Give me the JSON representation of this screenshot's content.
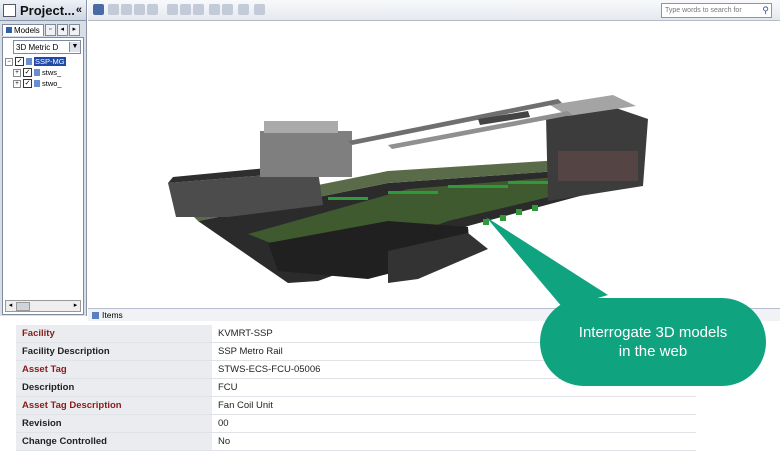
{
  "project_panel": {
    "title": "Project...",
    "collapse_glyph": "«",
    "tab_label": "Models",
    "view_select": "3D Metric D",
    "tree": [
      {
        "label": "SSP-MG",
        "selected": true,
        "expander": "−"
      },
      {
        "label": "stws_",
        "selected": false,
        "expander": "+"
      },
      {
        "label": "stwo_",
        "selected": false,
        "expander": "+"
      }
    ]
  },
  "toolbar": {
    "search_placeholder": "Type words to search for"
  },
  "status_bar": {
    "label": "Items"
  },
  "properties": [
    {
      "key": "Facility",
      "value": "KVMRT-SSP",
      "highlight": true
    },
    {
      "key": "Facility Description",
      "value": "SSP Metro Rail",
      "highlight": false
    },
    {
      "key": "Asset Tag",
      "value": "STWS-ECS-FCU-05006",
      "highlight": true
    },
    {
      "key": "Description",
      "value": "FCU",
      "highlight": false
    },
    {
      "key": "Asset Tag Description",
      "value": "Fan Coil Unit",
      "highlight": true
    },
    {
      "key": "Revision",
      "value": "00",
      "highlight": false
    },
    {
      "key": "Change Controlled",
      "value": "No",
      "highlight": false
    }
  ],
  "callout": {
    "text": "Interrogate 3D models in the web",
    "color": "#10a37f"
  }
}
